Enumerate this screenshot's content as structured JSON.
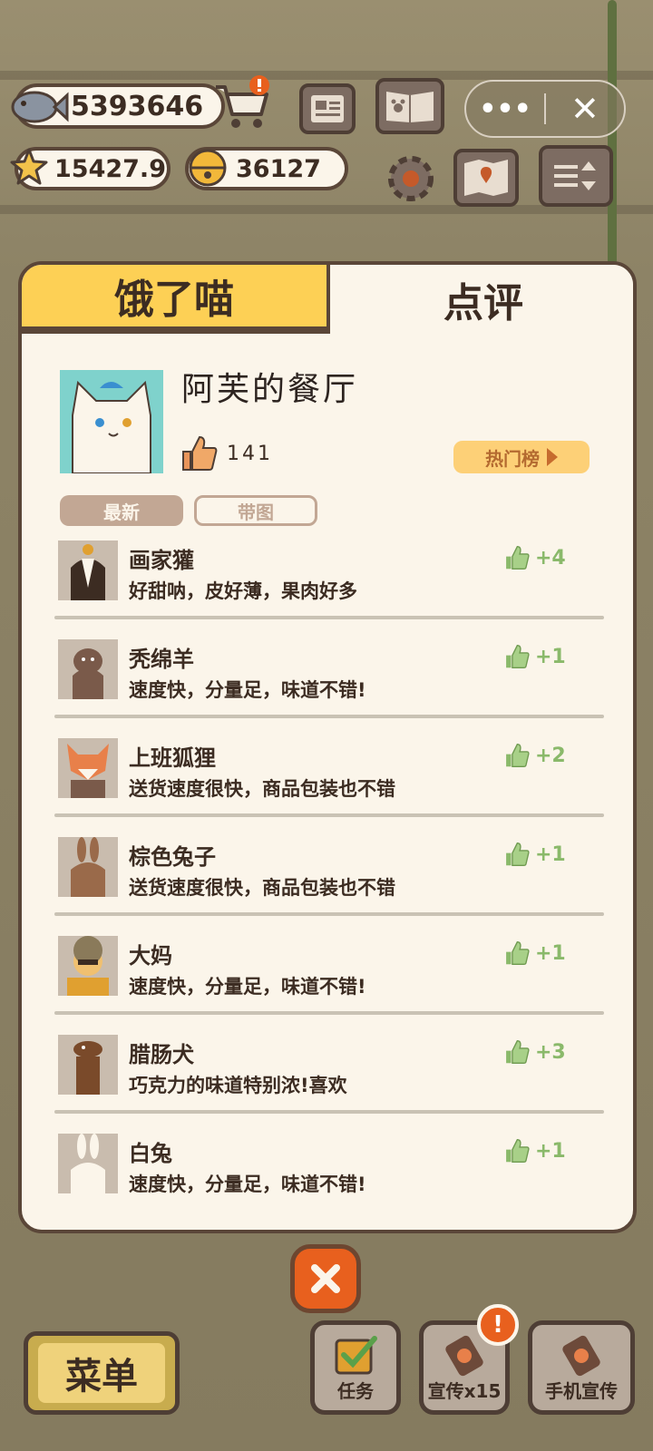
{
  "hud": {
    "fish_count": "5393646",
    "star_count": "15427.9",
    "bell_count": "36127"
  },
  "tabs": [
    {
      "label": "饿了喵",
      "active": false
    },
    {
      "label": "点评",
      "active": true
    }
  ],
  "restaurant": {
    "name": "阿芙的餐厅",
    "likes": "141",
    "hot_label": "热门榜"
  },
  "filters": {
    "latest": "最新",
    "with_image": "带图"
  },
  "reviews": [
    {
      "name": "画家獾",
      "comment": "好甜呐，皮好薄，果肉好多",
      "likes": "+4",
      "avatar": "badger-avatar"
    },
    {
      "name": "秃绵羊",
      "comment": "速度快，分量足，味道不错!",
      "likes": "+1",
      "avatar": "sheep-avatar"
    },
    {
      "name": "上班狐狸",
      "comment": "送货速度很快，商品包装也不错",
      "likes": "+2",
      "avatar": "fox-avatar"
    },
    {
      "name": "棕色兔子",
      "comment": "送货速度很快，商品包装也不错",
      "likes": "+1",
      "avatar": "brown-rabbit-avatar"
    },
    {
      "name": "大妈",
      "comment": "速度快，分量足，味道不错!",
      "likes": "+1",
      "avatar": "auntie-avatar"
    },
    {
      "name": "腊肠犬",
      "comment": "巧克力的味道特别浓!喜欢",
      "likes": "+3",
      "avatar": "dachshund-avatar"
    },
    {
      "name": "白兔",
      "comment": "速度快，分量足，味道不错!",
      "likes": "+1",
      "avatar": "white-rabbit-avatar"
    }
  ],
  "bottom": {
    "menu_label": "菜单",
    "task_label": "任务",
    "promote_label": "宣传x15",
    "phone_promote_label": "手机宣传"
  },
  "colors": {
    "accent_yellow": "#fdd055",
    "like_green": "#8ab96a",
    "close_orange": "#e8601e",
    "border_brown": "#5a4638"
  }
}
